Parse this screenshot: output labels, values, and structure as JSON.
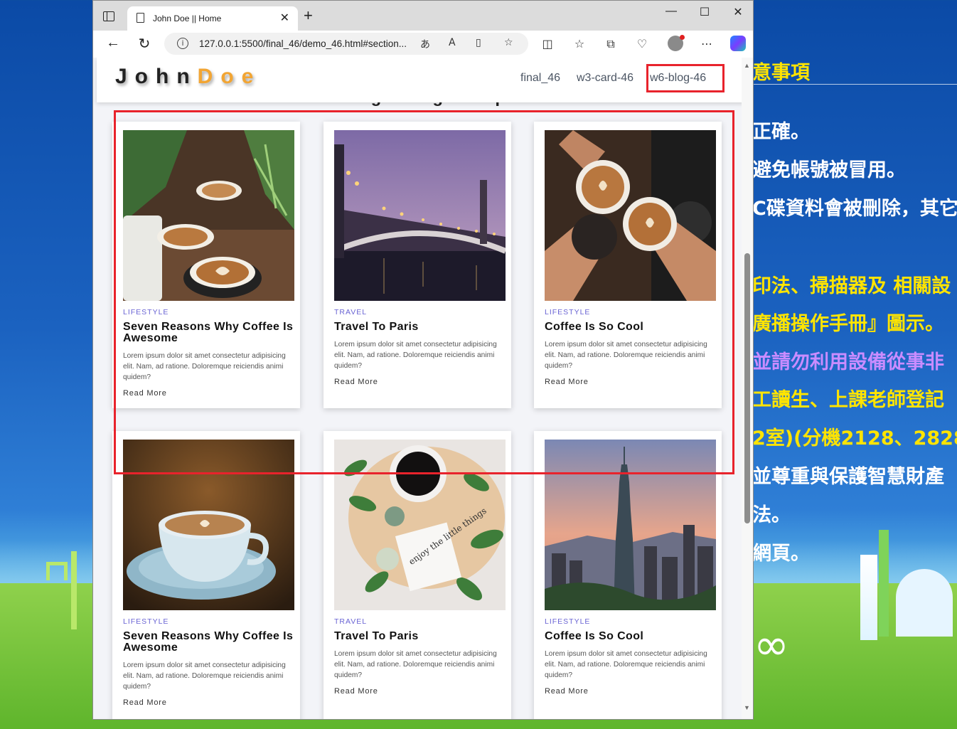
{
  "desktop": {
    "lines": [
      {
        "text": "意事項",
        "color": "y"
      },
      {
        "text": "正確。",
        "color": "w"
      },
      {
        "text": "避免帳號被冒用。",
        "color": "w"
      },
      {
        "text": "C碟資料會被刪除，其它",
        "color": "w"
      },
      {
        "text": "印法、掃描器及 相關設",
        "color": "y"
      },
      {
        "text": "廣播操作手冊』圖示。",
        "color": "y"
      },
      {
        "text": " 並請勿利用設備從事非",
        "color": "p"
      },
      {
        "text": "工讀生、上課老師登記",
        "color": "y"
      },
      {
        "text": "2室)(分機2128、2828",
        "color": "y"
      },
      {
        "text": "並尊重與保護智慧財產",
        "color": "w"
      },
      {
        "text": "法。",
        "color": "w"
      },
      {
        "text": "網頁。",
        "color": "w"
      }
    ]
  },
  "browser": {
    "tab_title": "John Doe || Home",
    "url": "127.0.0.1:5500/final_46/demo_46.html#section..."
  },
  "site": {
    "logo_part1": "John",
    "logo_part2": "Doe",
    "nav": [
      "final_46",
      "w3-card-46",
      "w6-blog-46"
    ],
    "section_title": "Latest Blogs Using Breakpoints"
  },
  "cards": [
    {
      "category": "LIFESTYLE",
      "title": "Seven Reasons Why Coffee Is Awesome",
      "body": "Lorem ipsum dolor sit amet consectetur adipisicing elit. Nam, ad ratione. Doloremque reiciendis animi quidem?",
      "link": "Read More",
      "image": "latte-art-cups"
    },
    {
      "category": "TRAVEL",
      "title": "Travel To Paris",
      "body": "Lorem ipsum dolor sit amet consectetur adipisicing elit. Nam, ad ratione. Doloremque reiciendis animi quidem?",
      "link": "Read More",
      "image": "paris-bridge-dusk"
    },
    {
      "category": "LIFESTYLE",
      "title": "Coffee Is So Cool",
      "body": "Lorem ipsum dolor sit amet consectetur adipisicing elit. Nam, ad ratione. Doloremque reiciendis animi quidem?",
      "link": "Read More",
      "image": "hands-toasting-coffee"
    },
    {
      "category": "LIFESTYLE",
      "title": "Seven Reasons Why Coffee Is Awesome",
      "body": "Lorem ipsum dolor sit amet consectetur adipisicing elit. Nam, ad ratione. Doloremque reiciendis animi quidem?",
      "link": "Read More",
      "image": "cappuccino-blue-saucer"
    },
    {
      "category": "TRAVEL",
      "title": "Travel To Paris",
      "body": "Lorem ipsum dolor sit amet consectetur adipisicing elit. Nam, ad ratione. Doloremque reiciendis animi quidem?",
      "link": "Read More",
      "image": "coffee-leaves-flatlay"
    },
    {
      "category": "LIFESTYLE",
      "title": "Coffee Is So Cool",
      "body": "Lorem ipsum dolor sit amet consectetur adipisicing elit. Nam, ad ratione. Doloremque reiciendis animi quidem?",
      "link": "Read More",
      "image": "taipei-101-skyline"
    }
  ],
  "flatlay_note": "enjoy the little things",
  "colors": {
    "accent": "#f2a533",
    "category": "#6a64d4",
    "annotation": "#e8232c"
  }
}
